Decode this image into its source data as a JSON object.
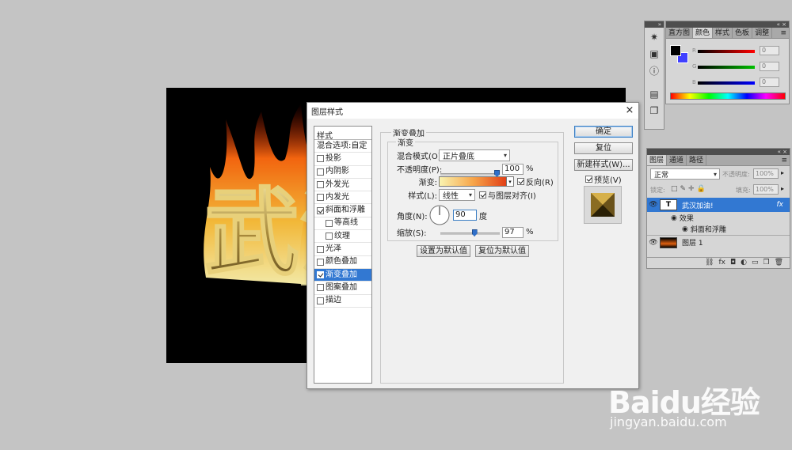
{
  "canvas": {
    "text": "武汉加油",
    "background": "#000000"
  },
  "dialog": {
    "title": "图层样式",
    "close_icon": "×",
    "style_list": {
      "header": "样式",
      "items": [
        {
          "label": "混合选项:自定",
          "checkbox": false,
          "checked": false,
          "indent": false
        },
        {
          "label": "投影",
          "checkbox": true,
          "checked": false,
          "indent": false
        },
        {
          "label": "内阴影",
          "checkbox": true,
          "checked": false,
          "indent": false
        },
        {
          "label": "外发光",
          "checkbox": true,
          "checked": false,
          "indent": false
        },
        {
          "label": "内发光",
          "checkbox": true,
          "checked": false,
          "indent": false
        },
        {
          "label": "斜面和浮雕",
          "checkbox": true,
          "checked": true,
          "indent": false
        },
        {
          "label": "等高线",
          "checkbox": true,
          "checked": false,
          "indent": true
        },
        {
          "label": "纹理",
          "checkbox": true,
          "checked": false,
          "indent": true
        },
        {
          "label": "光泽",
          "checkbox": true,
          "checked": false,
          "indent": false
        },
        {
          "label": "颜色叠加",
          "checkbox": true,
          "checked": false,
          "indent": false
        },
        {
          "label": "渐变叠加",
          "checkbox": true,
          "checked": true,
          "indent": false,
          "selected": true
        },
        {
          "label": "图案叠加",
          "checkbox": true,
          "checked": false,
          "indent": false
        },
        {
          "label": "描边",
          "checkbox": true,
          "checked": false,
          "indent": false
        }
      ]
    },
    "section_title": "渐变叠加",
    "subsection_title": "渐变",
    "blend_mode_label": "混合模式(O):",
    "blend_mode_value": "正片叠底",
    "opacity_label": "不透明度(P):",
    "opacity_value": "100",
    "opacity_level": 1.0,
    "percent": "%",
    "gradient_label": "渐变:",
    "reverse_label": "反向(R)",
    "reverse_checked": true,
    "style_label": "样式(L):",
    "style_value": "线性",
    "align_label": "与图层对齐(I)",
    "align_checked": true,
    "angle_label": "角度(N):",
    "angle_value": "90",
    "angle_unit": "度",
    "scale_label": "缩放(S):",
    "scale_value": "97",
    "scale_level": 0.97,
    "set_default_btn": "设置为默认值",
    "reset_default_btn": "复位为默认值",
    "ok_btn": "确定",
    "reset_btn": "复位",
    "new_style_btn": "新建样式(W)...",
    "preview_label": "预览(V)",
    "preview_checked": true
  },
  "color_panel": {
    "tabs": [
      "直方图",
      "颜色",
      "样式",
      "色板",
      "调整"
    ],
    "active_tab": "颜色",
    "channels": [
      {
        "label": "R",
        "value": "0",
        "color": "#e02020"
      },
      {
        "label": "G",
        "value": "0",
        "color": "#20c020"
      },
      {
        "label": "B",
        "value": "0",
        "color": "#2020e0"
      }
    ],
    "foreground": "#000000",
    "background": "#4040ff"
  },
  "layers_panel": {
    "tabs": [
      "图层",
      "通道",
      "路径"
    ],
    "active_tab": "图层",
    "blend_mode": "正常",
    "opacity_label": "不透明度:",
    "opacity_value": "100%",
    "lock_label": "锁定:",
    "fill_label": "填充:",
    "fill_value": "100%",
    "layers": [
      {
        "name": "武汉加油!",
        "type": "text",
        "thumb": "T",
        "selected": true,
        "fx": "fx"
      },
      {
        "name": "效果",
        "type": "effects"
      },
      {
        "name": "斜面和浮雕",
        "type": "effect"
      },
      {
        "name": "图层 1",
        "type": "image"
      }
    ]
  },
  "watermark": {
    "logo": "Baidu经验",
    "url": "jingyan.baidu.com"
  }
}
